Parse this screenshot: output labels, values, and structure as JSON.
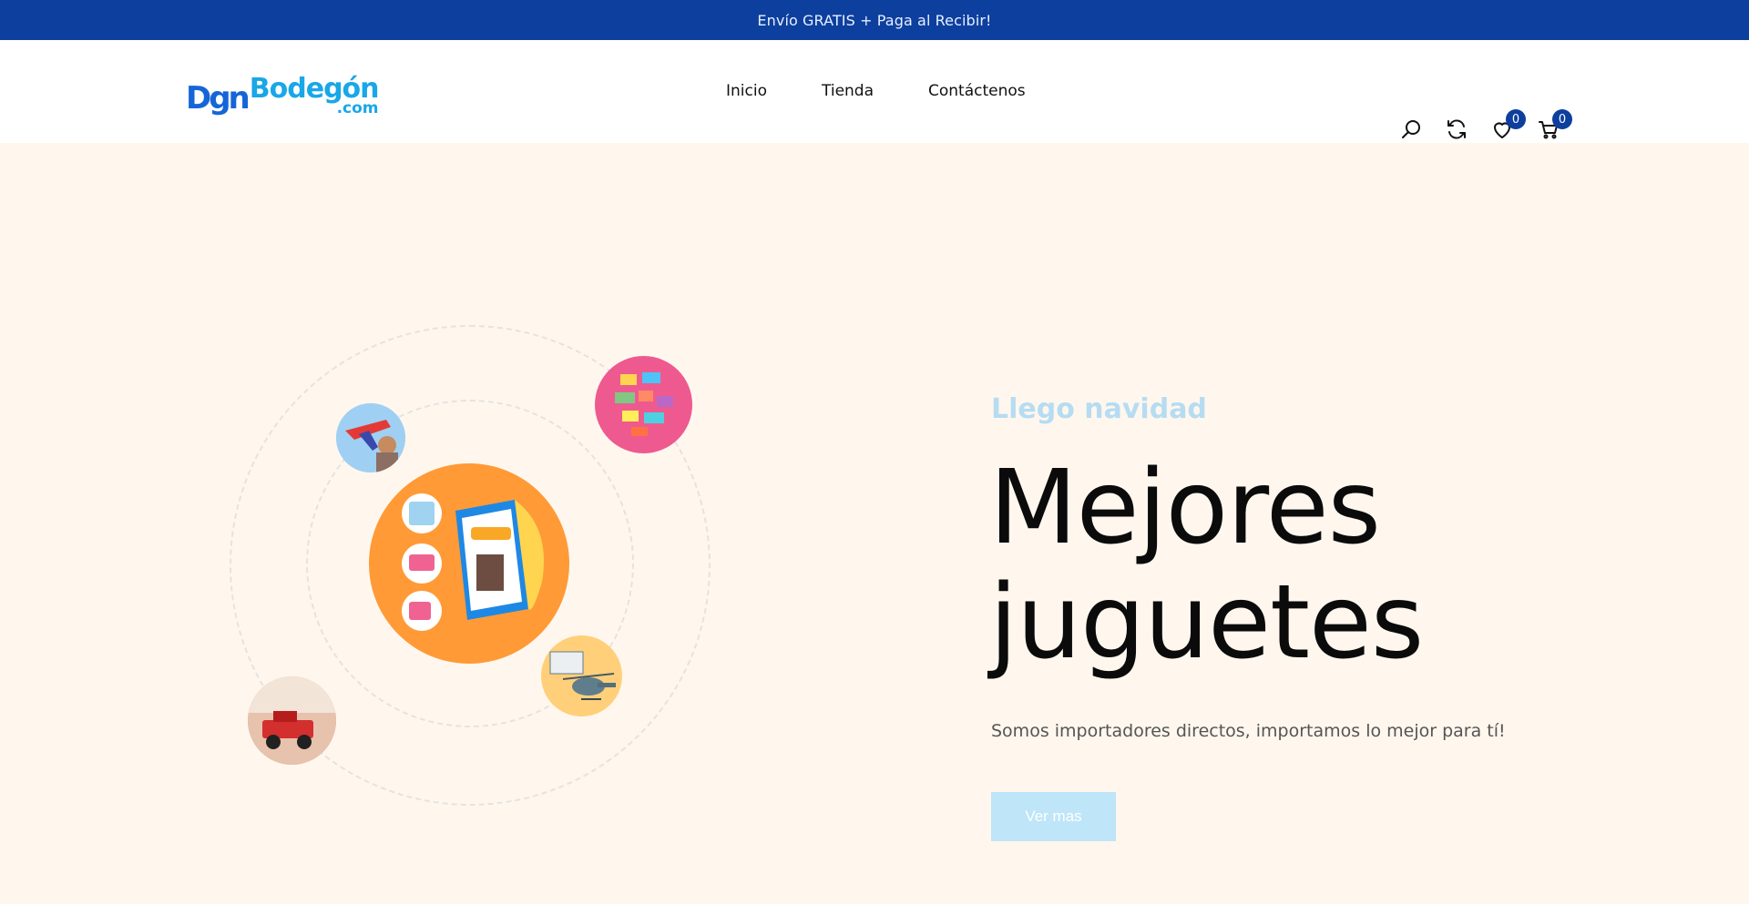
{
  "announcement": "Envío GRATIS + Paga al Recibir!",
  "logo": {
    "mark": "Dgn",
    "name": "Bodegón",
    "domain": ".com"
  },
  "nav": [
    {
      "label": "Inicio"
    },
    {
      "label": "Tienda"
    },
    {
      "label": "Contáctenos"
    }
  ],
  "header_icons": {
    "search": "search-icon",
    "compare": "compare-icon",
    "wishlist": "heart-icon",
    "cart": "cart-icon",
    "wishlist_count": "0",
    "cart_count": "0"
  },
  "hero": {
    "eyebrow": "Llego navidad",
    "headline_line1": "Mejores",
    "headline_line2": "juguetes",
    "subtitle": "Somos importadores directos, importamos lo mejor para tí!",
    "cta_label": "Ver mas"
  },
  "colors": {
    "topbar": "#0d3f9e",
    "hero_bg": "#fff7ee",
    "accent_light_blue": "#bee5f8",
    "center_bubble": "#ff9a37",
    "pink_bubble": "#ee5a8f",
    "yellow_bubble": "#ffcf7a"
  }
}
